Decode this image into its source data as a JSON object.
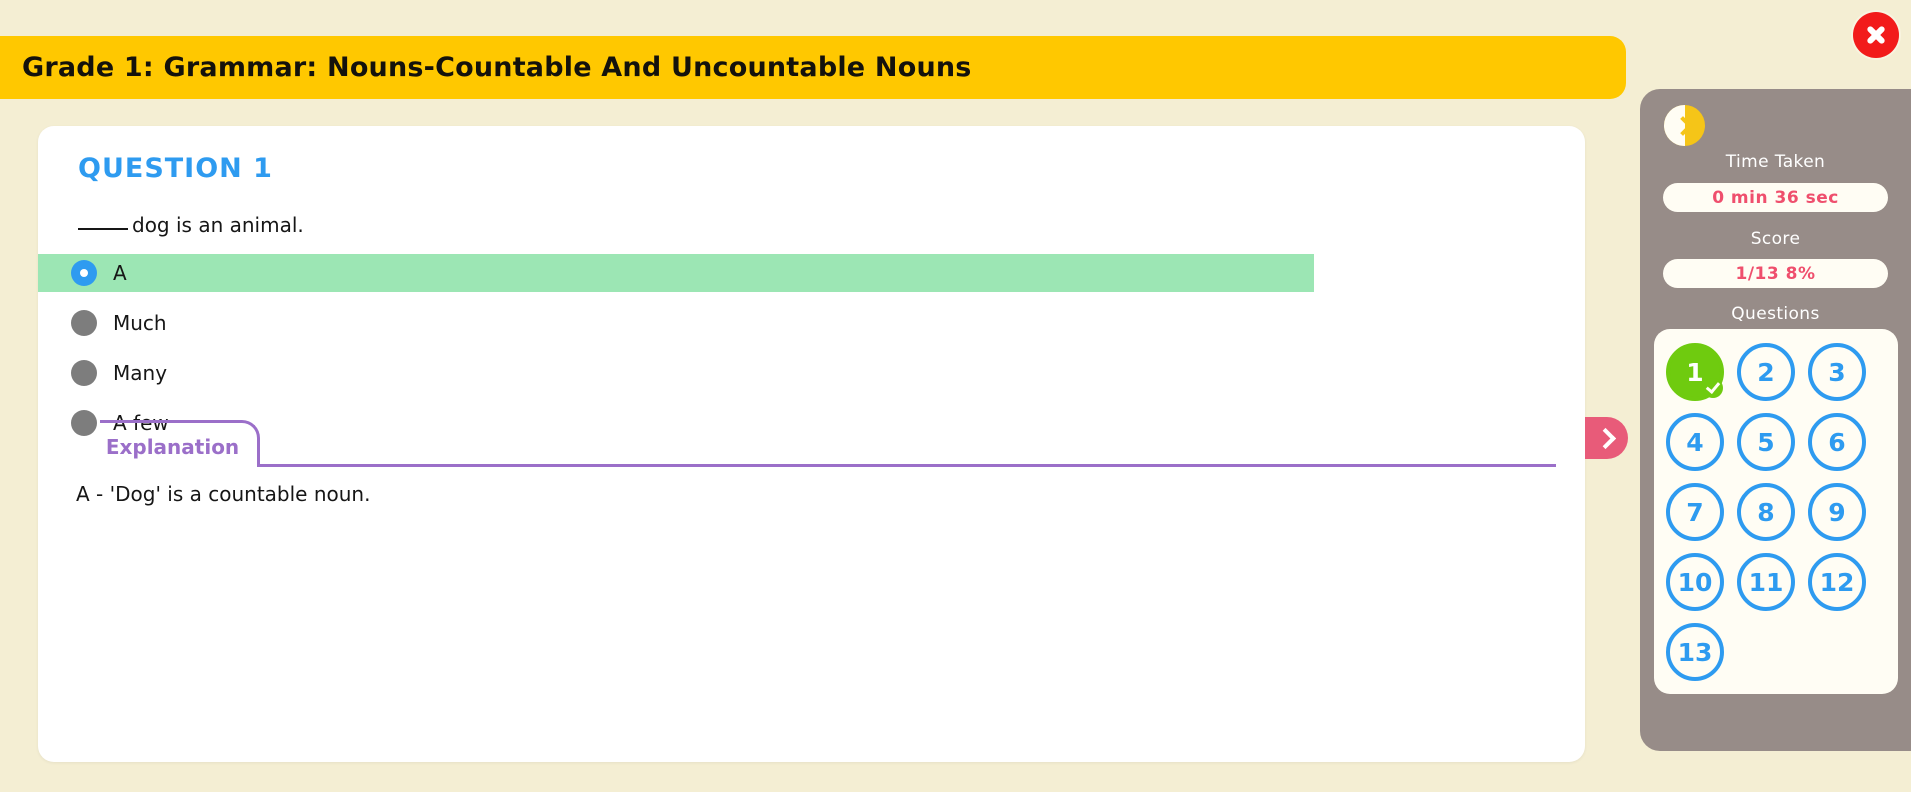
{
  "header": {
    "title": "Grade 1: Grammar: Nouns-Countable And Uncountable Nouns",
    "close_icon": "close-icon"
  },
  "question": {
    "heading": "QUESTION 1",
    "prompt_blank": "",
    "prompt_text": "dog is an animal.",
    "options": [
      {
        "label": "A",
        "selected": true
      },
      {
        "label": "Much",
        "selected": false
      },
      {
        "label": "Many",
        "selected": false
      },
      {
        "label": "A few",
        "selected": false
      }
    ]
  },
  "explanation": {
    "tab_label": "Explanation",
    "text": "A - 'Dog' is a countable noun."
  },
  "panel_toggle": {
    "icon": "chevron-right-icon"
  },
  "sidebar": {
    "collapse_icon": "chevron-right-icon",
    "time_label": "Time Taken",
    "time_value": "0 min 36 sec",
    "score_label": "Score",
    "score_value": "1/13 8%",
    "questions_label": "Questions",
    "questions": [
      {
        "number": "1",
        "state": "correct"
      },
      {
        "number": "2",
        "state": "unanswered"
      },
      {
        "number": "3",
        "state": "unanswered"
      },
      {
        "number": "4",
        "state": "unanswered"
      },
      {
        "number": "5",
        "state": "unanswered"
      },
      {
        "number": "6",
        "state": "unanswered"
      },
      {
        "number": "7",
        "state": "unanswered"
      },
      {
        "number": "8",
        "state": "unanswered"
      },
      {
        "number": "9",
        "state": "unanswered"
      },
      {
        "number": "10",
        "state": "unanswered"
      },
      {
        "number": "11",
        "state": "unanswered"
      },
      {
        "number": "12",
        "state": "unanswered"
      },
      {
        "number": "13",
        "state": "unanswered"
      }
    ]
  },
  "colors": {
    "page_bg": "#f4eed3",
    "title_bar": "#ffc800",
    "accent_blue": "#2e9bf0",
    "correct_green": "#6fcb0f",
    "selected_row": "#9ce6b4",
    "explanation_purple": "#9b6fc9",
    "sidebar_bg": "#978c88",
    "pill_text": "#ef4f6d",
    "close_red": "#f21b1b",
    "toggle_pink": "#e85b79"
  }
}
